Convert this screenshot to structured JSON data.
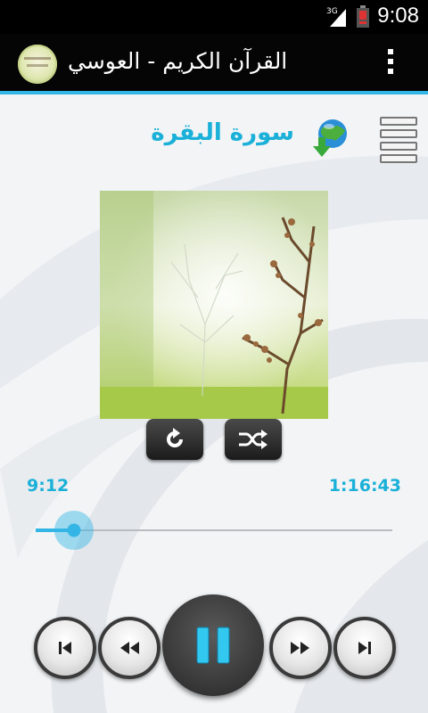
{
  "status_bar": {
    "time": "9:08",
    "network": "3G"
  },
  "action_bar": {
    "title": "القرآن الكريم - العوسي"
  },
  "player": {
    "surah_title": "سورة البقرة",
    "current_time": "9:12",
    "total_time": "1:16:43",
    "progress": 0.108,
    "state": "playing"
  },
  "icons": {
    "menu": "overflow-menu-icon",
    "playlist": "list-icon",
    "download": "globe-download-icon",
    "repeat": "repeat-icon",
    "shuffle": "shuffle-icon",
    "prev": "skip-previous-icon",
    "rewind": "rewind-icon",
    "pause": "pause-icon",
    "forward": "fast-forward-icon",
    "next": "skip-next-icon"
  },
  "colors": {
    "accent": "#33b5e5",
    "title_text": "#1ab0d8",
    "pause_bars": "#33c8f0"
  }
}
